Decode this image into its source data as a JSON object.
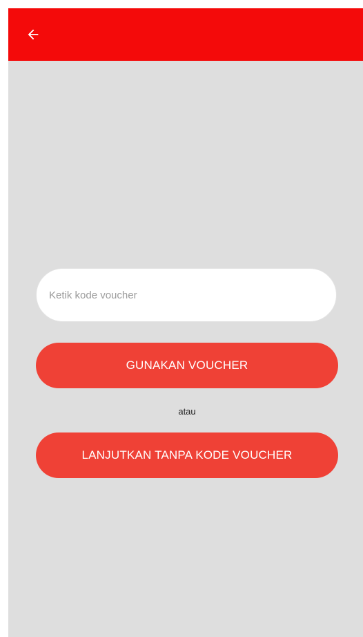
{
  "app_bar": {
    "back_icon": "arrow-left-icon",
    "color": "#f40a0a"
  },
  "voucher_form": {
    "input_placeholder": "Ketik kode voucher",
    "input_value": "",
    "apply_label": "GUNAKAN VOUCHER",
    "separator": "atau",
    "continue_label": "LANJUTKAN TANPA KODE VOUCHER",
    "button_color": "#ef4136"
  },
  "background_color": "#dedede"
}
